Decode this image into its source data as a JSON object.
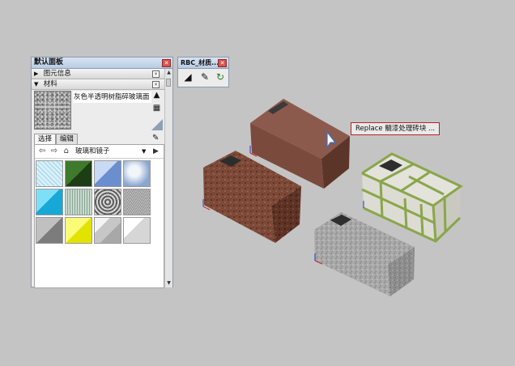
{
  "tray": {
    "title": "默认面板",
    "close": "✕",
    "sections": [
      {
        "label": "图元信息",
        "expanded": false,
        "arrow": "▶"
      },
      {
        "label": "材料",
        "expanded": true,
        "arrow": "▼"
      }
    ],
    "materials": {
      "current_name": "灰色半透明树脂碎玻璃面",
      "tabs": [
        "选择",
        "编辑"
      ],
      "active_tab": "选择",
      "collection": "玻璃和镜子",
      "swatches": [
        {
          "name": "glass-grid-blue",
          "color": "#b7dff0"
        },
        {
          "name": "glass-green-dark",
          "color": "#2f5e22"
        },
        {
          "name": "glass-blue-gradient",
          "color": "#86a8dc"
        },
        {
          "name": "glass-sky",
          "color": "#9eb6d8"
        },
        {
          "name": "glass-cyan",
          "color": "#35c4ea"
        },
        {
          "name": "glass-ribbed-green",
          "color": "#a8c2b0"
        },
        {
          "name": "glass-patterned-gray",
          "color": "#8e8e8e"
        },
        {
          "name": "glass-speckled-gray",
          "color": "#a6a6a6"
        },
        {
          "name": "glass-gray-diagonal",
          "color": "#9a9a9a"
        },
        {
          "name": "glass-yellow",
          "color": "#f1f133"
        },
        {
          "name": "glass-frosted-steps",
          "color": "#d8d8d8"
        },
        {
          "name": "glass-white-gradient",
          "color": "#ececec"
        }
      ]
    }
  },
  "rbc_window": {
    "title": "RBC_材质...",
    "close": "✕"
  },
  "viewport": {
    "tooltip": "Replace 髓漆处理砖块 ..."
  },
  "colors": {
    "viewport_bg": "#c4c4c4",
    "title_bar": "#c8d7ec",
    "tooltip_border": "#b22222"
  }
}
